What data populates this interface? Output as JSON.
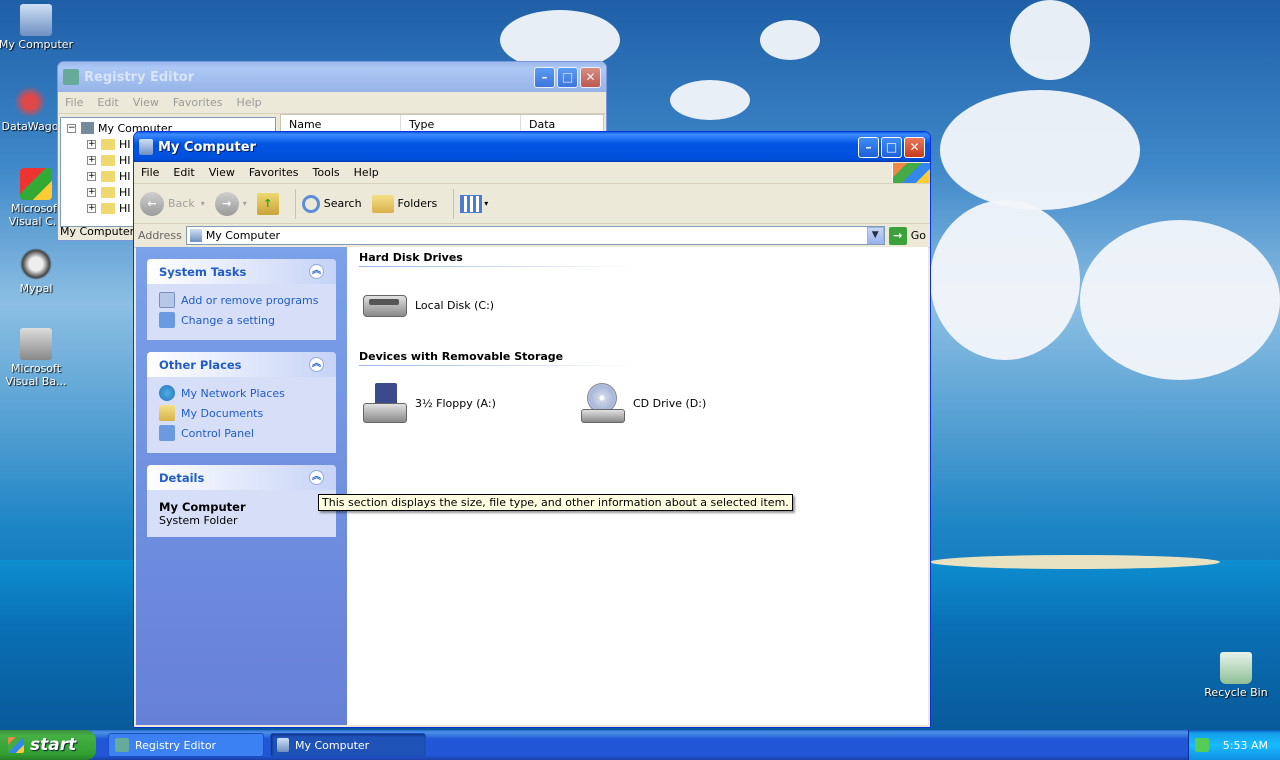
{
  "desktop": {
    "icons": [
      {
        "label": "My Computer",
        "icon": "my-computer-icon"
      },
      {
        "label": "DataWago",
        "icon": "datawago-icon"
      },
      {
        "label": "Microsoft Visual C...",
        "icon": "visual-c-icon"
      },
      {
        "label": "Mypal",
        "icon": "mypal-icon"
      },
      {
        "label": "Microsoft Visual Ba...",
        "icon": "visual-basic-icon"
      },
      {
        "label": "Recycle Bin",
        "icon": "recycle-bin-icon"
      }
    ]
  },
  "registry_editor": {
    "title": "Registry Editor",
    "menu": [
      "File",
      "Edit",
      "View",
      "Favorites",
      "Help"
    ],
    "tree_root": "My Computer",
    "tree_items": [
      "HI",
      "HI",
      "HI",
      "HI",
      "HI"
    ],
    "columns": [
      "Name",
      "Type",
      "Data"
    ],
    "status": "My Computer\\H"
  },
  "my_computer": {
    "title": "My Computer",
    "menu": [
      "File",
      "Edit",
      "View",
      "Favorites",
      "Tools",
      "Help"
    ],
    "toolbar": {
      "back": "Back",
      "search": "Search",
      "folders": "Folders"
    },
    "address_label": "Address",
    "address_value": "My Computer",
    "go_label": "Go",
    "system_tasks": {
      "title": "System Tasks",
      "links": [
        "Add or remove programs",
        "Change a setting"
      ]
    },
    "other_places": {
      "title": "Other Places",
      "links": [
        "My Network Places",
        "My Documents",
        "Control Panel"
      ]
    },
    "details": {
      "title": "Details",
      "name": "My Computer",
      "type": "System Folder"
    },
    "groups": {
      "hard_disks": {
        "title": "Hard Disk Drives",
        "items": [
          "Local Disk (C:)"
        ]
      },
      "removable": {
        "title": "Devices with Removable Storage",
        "items": [
          "3½ Floppy (A:)",
          "CD Drive (D:)"
        ]
      }
    },
    "tooltip": "This section displays the size, file type, and other information about a selected item."
  },
  "taskbar": {
    "start_label": "start",
    "tasks": [
      "Registry Editor",
      "My Computer"
    ],
    "clock": "5:53 AM"
  }
}
